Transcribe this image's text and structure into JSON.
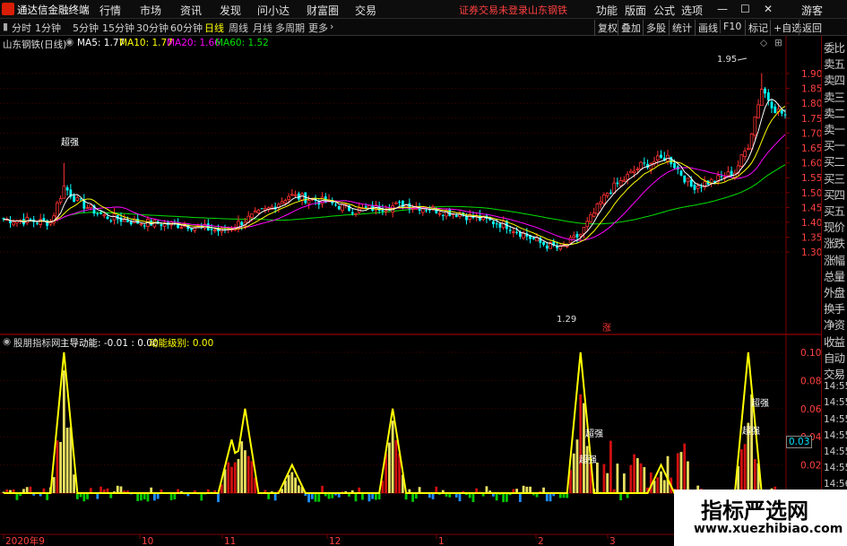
{
  "app": {
    "title": "通达信金融终端",
    "notice": "证券交易未登录",
    "stock_name_top": "山东钢铁"
  },
  "menus": [
    "行情",
    "市场",
    "资讯",
    "发现",
    "问小达",
    "财富圈",
    "交易"
  ],
  "right_menus": [
    "功能",
    "版面",
    "公式",
    "选项",
    "游客"
  ],
  "window_buttons": {
    "min": "—",
    "max": "☐",
    "close": "✕"
  },
  "periods": [
    "分时",
    "1分钟",
    "5分钟",
    "15分钟",
    "30分钟",
    "60分钟",
    "日线",
    "周线",
    "月线",
    "多周期",
    "更多"
  ],
  "active_period": "日线",
  "right_tools": [
    "复权",
    "叠加",
    "多股",
    "统计",
    "画线",
    "F10",
    "标记",
    "+自选",
    "返回"
  ],
  "main_chart": {
    "title": "山东钢铁(日线)",
    "ma": [
      {
        "label": "MA5: 1.77",
        "color": "#ffffff"
      },
      {
        "label": "MA10: 1.77",
        "color": "#ffff00"
      },
      {
        "label": "MA20: 1.66",
        "color": "#ff00ff"
      },
      {
        "label": "MA60: 1.52",
        "color": "#00e000"
      }
    ],
    "y_ticks": [
      "1.90",
      "1.85",
      "1.80",
      "1.75",
      "1.70",
      "1.65",
      "1.60",
      "1.55",
      "1.50",
      "1.45",
      "1.40",
      "1.35",
      "1.30"
    ],
    "y_values": [
      1.9,
      1.85,
      1.8,
      1.75,
      1.7,
      1.65,
      1.6,
      1.55,
      1.5,
      1.45,
      1.4,
      1.35,
      1.3
    ],
    "high_label": "1.95",
    "low_label": "1.29",
    "zhang_label": "涨"
  },
  "sub_chart": {
    "title": "股朋指标网",
    "legend": [
      {
        "label": "主导动能: -0.01 : 0.00",
        "color": "#ffffff"
      },
      {
        "label": "动能级别: 0.00",
        "color": "#ffff00"
      }
    ],
    "y_ticks": [
      "0.10",
      "0.08",
      "0.06",
      "0.04",
      "0.02"
    ],
    "current_value": "0.03",
    "tag": "超强"
  },
  "x_axis": [
    "2020年9",
    "10",
    "11",
    "12",
    "1",
    "2",
    "3"
  ],
  "right_panel": [
    "委比",
    "卖五",
    "卖四",
    "卖三",
    "卖二",
    "卖一",
    "买一",
    "买二",
    "买三",
    "买四",
    "买五",
    "现价",
    "涨跌",
    "涨幅",
    "总量",
    "外盘",
    "换手",
    "净资",
    "收益",
    "自动",
    "交易",
    "14:55",
    "14:55",
    "14:55",
    "14:55",
    "14:55",
    "14:55",
    "14:56",
    "14:56",
    "14:56"
  ],
  "watermark": {
    "main": "指标严选网",
    "sub": "www.xuezhibiao.com"
  },
  "colors": {
    "up": "#ff3232",
    "down": "#00ffff",
    "border": "#7a0000",
    "ma60": "#00e000",
    "ma20": "#ff00ff",
    "ma10": "#ffff00",
    "ma5": "#ffffff"
  }
}
